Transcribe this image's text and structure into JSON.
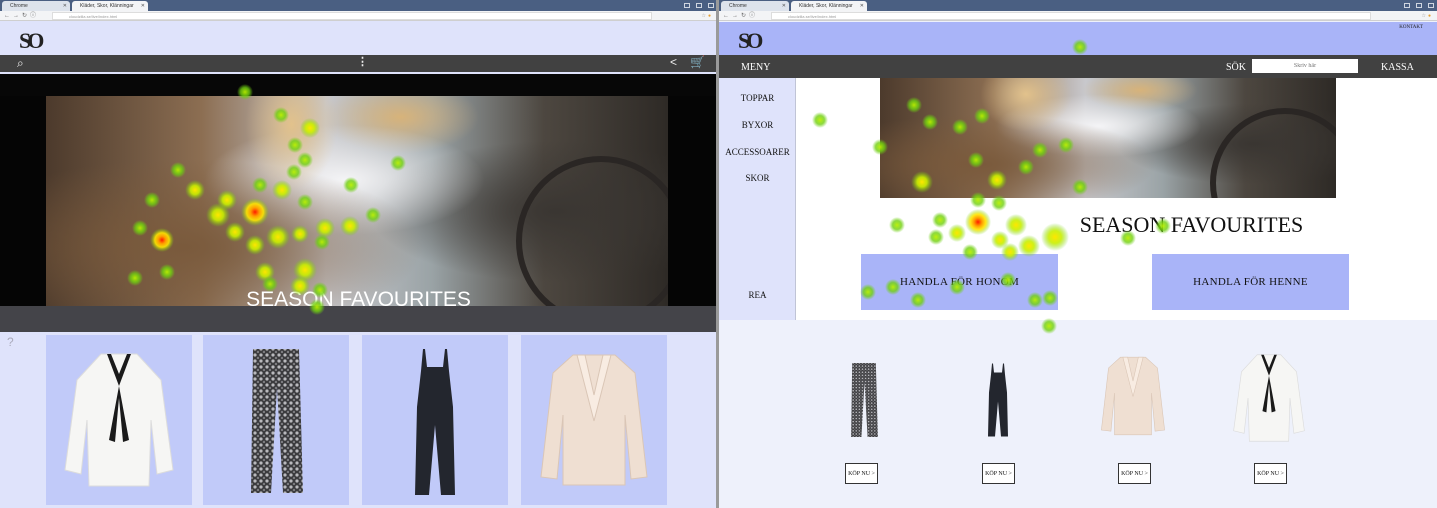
{
  "left_browser": {
    "tabs": [
      {
        "label": "Chrome"
      },
      {
        "label": "Kläder, Skor, Klänningar"
      }
    ],
    "url": "cloudzilla.se/live/index.html",
    "icons": [
      "back-arrow-icon",
      "forward-arrow-icon",
      "reload-icon",
      "info-icon",
      "bookmark-star-icon",
      "menu-icon"
    ]
  },
  "right_browser": {
    "tabs": [
      {
        "label": "Chrome"
      },
      {
        "label": "Kläder, Skor, Klänningar"
      }
    ],
    "url": "cloudzilla.se/live/index.html",
    "icons": [
      "back-arrow-icon",
      "forward-arrow-icon",
      "reload-icon",
      "info-icon",
      "bookmark-star-icon",
      "menu-icon"
    ]
  },
  "left_site": {
    "logo": "SO",
    "nav_icons": [
      "search-icon",
      "more-vertical-icon",
      "share-icon",
      "cart-icon"
    ],
    "hero_title": "SEASON FAVOURITES",
    "help_mark": "?",
    "products": [
      {
        "name": "blouse",
        "icon": "white-bow-blouse"
      },
      {
        "name": "trousers",
        "icon": "sequin-trousers"
      },
      {
        "name": "jumpsuit",
        "icon": "black-jumpsuit"
      },
      {
        "name": "blazer",
        "icon": "beige-blazer"
      }
    ]
  },
  "right_site": {
    "logo": "SO",
    "kontakt": "KONTAKT",
    "menu_label": "MENY",
    "search_label": "SÖK",
    "search_placeholder": "Skriv här",
    "checkout_label": "KASSA",
    "sidebar": [
      "TOPPAR",
      "BYXOR",
      "ACCESSOARER",
      "SKOR",
      "REA"
    ],
    "hero_title": "SEASON FAVOURITES",
    "cta_him": "HANDLA FÖR HONOM",
    "cta_her": "HANDLA FÖR HENNE",
    "products": [
      {
        "name": "trousers",
        "buy_label": "KÖP NU  >"
      },
      {
        "name": "jumpsuit",
        "buy_label": "KÖP NU  >"
      },
      {
        "name": "blazer",
        "buy_label": "KÖP NU  >"
      },
      {
        "name": "blouse",
        "buy_label": "KÖP NU  >"
      }
    ]
  },
  "colors": {
    "left_header_bg": "#dfe3fb",
    "right_header_bg": "#a9b4f8",
    "navbar_bg": "#414141",
    "card_bg": "#c1caf9",
    "heat_low": "#7dd41a",
    "heat_mid": "#ffe600",
    "heat_high": "#ff1a00"
  }
}
